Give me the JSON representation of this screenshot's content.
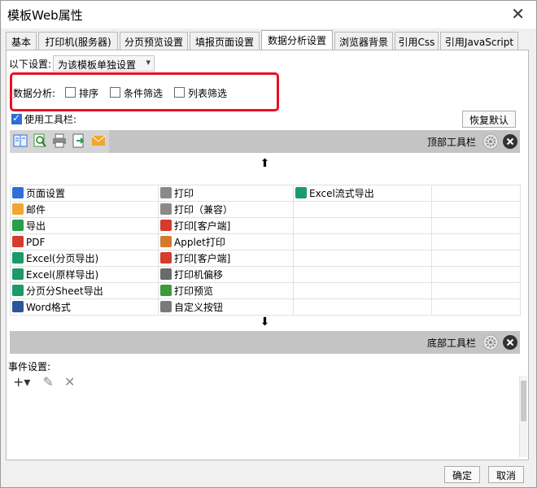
{
  "window": {
    "title": "模板Web属性",
    "close": "✕"
  },
  "tabs": [
    "基本",
    "打印机(服务器)",
    "分页预览设置",
    "填报页面设置",
    "数据分析设置",
    "浏览器背景",
    "引用Css",
    "引用JavaScript"
  ],
  "setting": {
    "label": "以下设置:",
    "value": "为该模板单独设置",
    "arrow": "▾"
  },
  "analysis": {
    "label": "数据分析:",
    "options": [
      {
        "label": "排序",
        "checked": false
      },
      {
        "label": "条件筛选",
        "checked": false
      },
      {
        "label": "列表筛选",
        "checked": false
      }
    ]
  },
  "toolbar_toggle": {
    "label": "使用工具栏:",
    "checked": true
  },
  "restore_label": "恢复默认",
  "top_toolbar": {
    "label": "顶部工具栏",
    "icons": [
      "page-setup-icon",
      "preview-icon",
      "print-icon",
      "export-icon",
      "mail-icon"
    ]
  },
  "bottom_toolbar": {
    "label": "底部工具栏"
  },
  "arrows": {
    "up": "⬆",
    "down": "⬇"
  },
  "buttons": [
    [
      "页面设置",
      "打印",
      "Excel流式导出",
      ""
    ],
    [
      "邮件",
      "打印（兼容）",
      "",
      ""
    ],
    [
      "导出",
      "打印[客户端]",
      "",
      ""
    ],
    [
      "PDF",
      "Applet打印",
      "",
      ""
    ],
    [
      "Excel(分页导出)",
      "打印[客户端]",
      "",
      ""
    ],
    [
      "Excel(原样导出)",
      "打印机偏移",
      "",
      ""
    ],
    [
      "分页分Sheet导出",
      "打印预览",
      "",
      ""
    ],
    [
      "Word格式",
      "自定义按钮",
      "",
      ""
    ]
  ],
  "button_colors": [
    [
      "#2f6ed6",
      "#8a8a8a",
      "#1b9a6a",
      ""
    ],
    [
      "#f0a630",
      "#8a8a8a",
      "",
      ""
    ],
    [
      "#2a9d4a",
      "#d43c2c",
      "",
      ""
    ],
    [
      "#d43c2c",
      "#d47a2c",
      "",
      ""
    ],
    [
      "#1b9a6a",
      "#d43c2c",
      "",
      ""
    ],
    [
      "#1b9a6a",
      "#6a6a6a",
      "",
      ""
    ],
    [
      "#1b9a6a",
      "#3c9a3c",
      "",
      ""
    ],
    [
      "#2a5599",
      "#7a7a7a",
      "",
      ""
    ]
  ],
  "events": {
    "label": "事件设置:",
    "add": "+▾",
    "edit": "✎",
    "delete": "✕"
  },
  "footer": {
    "ok": "确定",
    "cancel": "取消"
  }
}
